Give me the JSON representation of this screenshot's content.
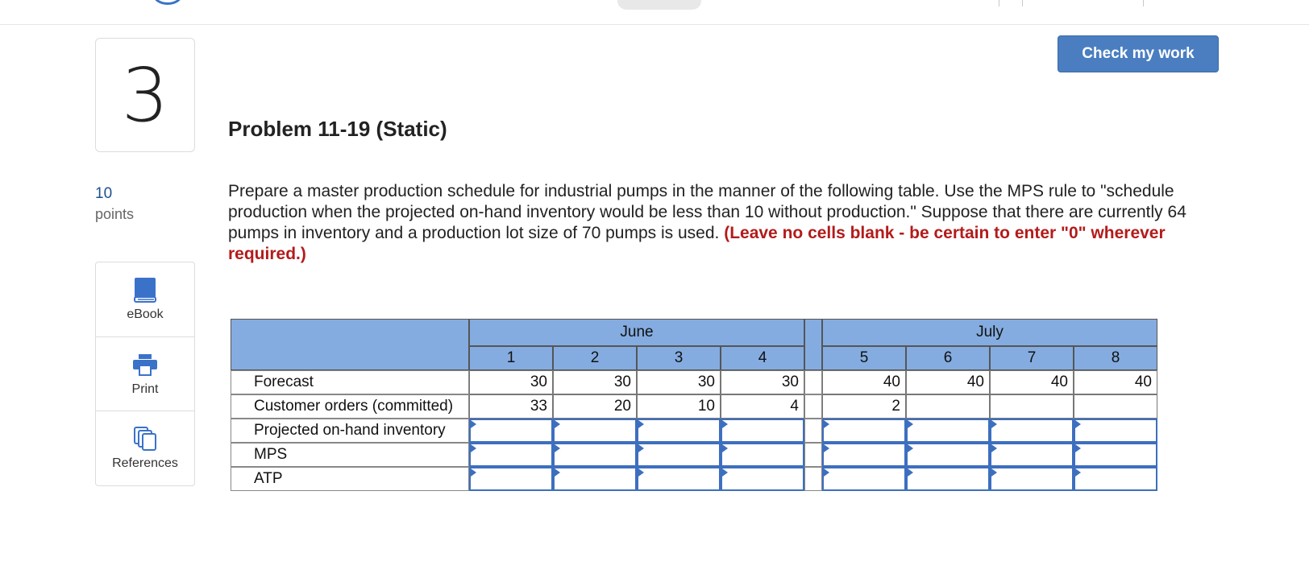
{
  "question": {
    "number": "3",
    "points_value": "10",
    "points_label": "points",
    "title": "Problem 11-19 (Static)",
    "prompt": "Prepare a master production schedule for industrial pumps in the manner of the following table. Use the MPS rule to \"schedule production when the projected on-hand inventory would be less than 10 without production.\" Suppose that there are currently 64 pumps in inventory and a production lot size of 70 pumps is used.",
    "instruction": "(Leave no cells blank - be certain to enter \"0\" wherever required.)"
  },
  "toolbar": {
    "check_label": "Check my work"
  },
  "tools": [
    {
      "label": "eBook",
      "icon": "book-icon"
    },
    {
      "label": "Print",
      "icon": "printer-icon"
    },
    {
      "label": "References",
      "icon": "documents-icon"
    }
  ],
  "table": {
    "months": [
      "June",
      "July"
    ],
    "weeks": [
      "1",
      "2",
      "3",
      "4",
      "5",
      "6",
      "7",
      "8"
    ],
    "rows": [
      {
        "label": "Forecast",
        "values": [
          "30",
          "30",
          "30",
          "30",
          "40",
          "40",
          "40",
          "40"
        ]
      },
      {
        "label": "Customer orders (committed)",
        "values": [
          "33",
          "20",
          "10",
          "4",
          "2",
          "",
          "",
          ""
        ]
      },
      {
        "label": "Projected on-hand inventory",
        "values": [
          "",
          "",
          "",
          "",
          "",
          "",
          "",
          ""
        ]
      },
      {
        "label": "MPS",
        "values": [
          "",
          "",
          "",
          "",
          "",
          "",
          "",
          ""
        ]
      },
      {
        "label": "ATP",
        "values": [
          "",
          "",
          "",
          "",
          "",
          "",
          "",
          ""
        ]
      }
    ],
    "input_rows": [
      2,
      3,
      4
    ]
  },
  "colors": {
    "accent": "#4a7ec1",
    "header_fill": "#84ace0",
    "warning_text": "#b31b1b",
    "points_text": "#1e4f8f"
  }
}
